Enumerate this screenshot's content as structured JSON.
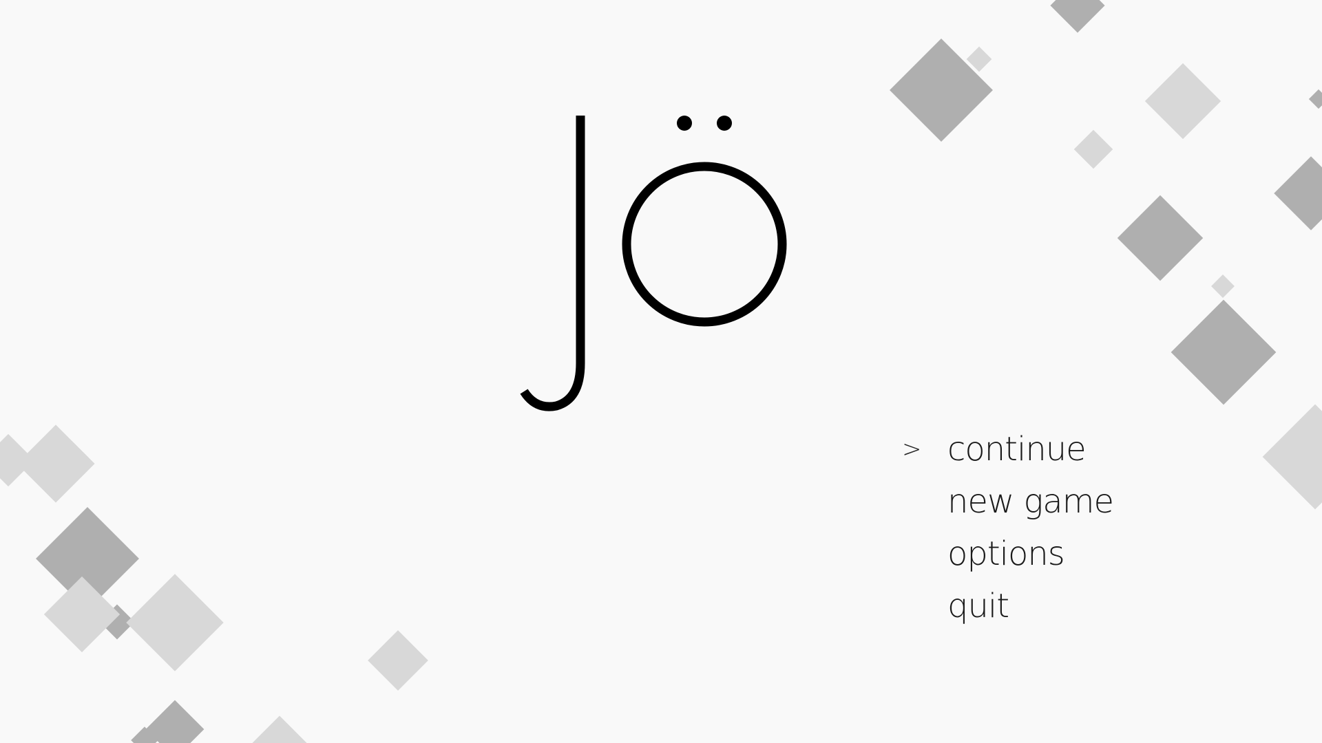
{
  "game": {
    "title_logo": "jö"
  },
  "menu": {
    "cursor": ">",
    "selected_index": 0,
    "items": [
      {
        "id": "continue",
        "label": "continue"
      },
      {
        "id": "new-game",
        "label": "new game"
      },
      {
        "id": "options",
        "label": "options"
      },
      {
        "id": "quit",
        "label": "quit"
      }
    ]
  },
  "colors": {
    "background": "#f9f9f9",
    "logo": "#000000",
    "menu_text": "#1a1a1a",
    "diamond_dark": "#afafaf",
    "diamond_light": "#d8d8d8"
  }
}
